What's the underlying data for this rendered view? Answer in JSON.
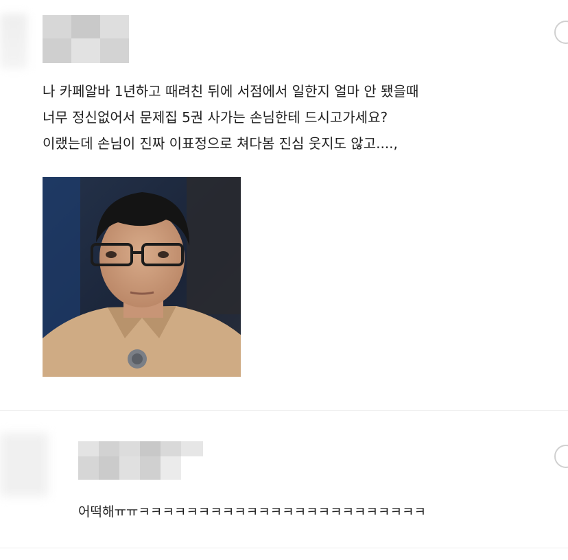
{
  "post": {
    "lines": [
      "나 카페알바 1년하고 때려친 뒤에 서점에서 일한지 얼마 안 됐을때",
      "너무 정신없어서 문제집 5권 사가는 손님한테 드시고가세요?",
      "이랬는데 손님이 진짜 이표정으로 쳐다봄 진심 웃지도 않고....,"
    ]
  },
  "comment": {
    "text": "어떡해ㅠㅠㅋㅋㅋㅋㅋㅋㅋㅋㅋㅋㅋㅋㅋㅋㅋㅋㅋㅋㅋㅋㅋㅋㅋㅋ"
  },
  "icons": {
    "post_avatar": "blurred-avatar",
    "comment_avatar": "blurred-avatar",
    "reply": "circle-icon"
  }
}
